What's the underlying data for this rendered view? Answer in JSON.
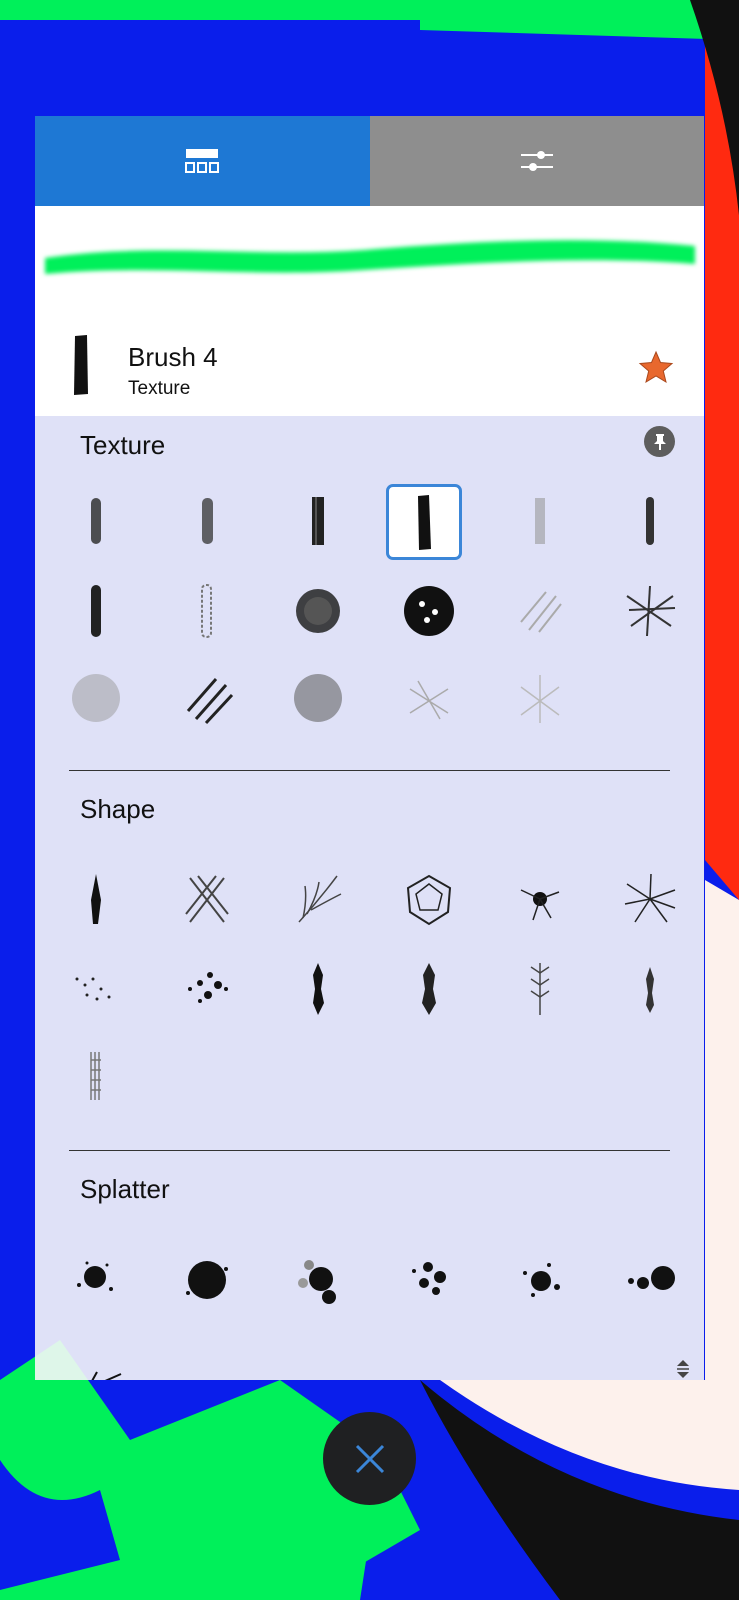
{
  "tabs": [
    {
      "icon": "brush-library-icon",
      "active": true
    },
    {
      "icon": "sliders-icon",
      "active": false
    }
  ],
  "current_brush": {
    "name": "Brush 4",
    "category": "Texture",
    "favorite": true
  },
  "sections": [
    {
      "title": "Texture",
      "count": 17,
      "selected_index": 3
    },
    {
      "title": "Shape",
      "count": 13
    },
    {
      "title": "Splatter",
      "count": 7
    }
  ],
  "colors": {
    "accent": "#1E78D4",
    "tab_inactive": "#8E8E8E",
    "stroke_preview": "#00F05A",
    "favorite_star": "#E8682E",
    "close_button": "#1F2022",
    "close_x": "#3B86D8"
  }
}
